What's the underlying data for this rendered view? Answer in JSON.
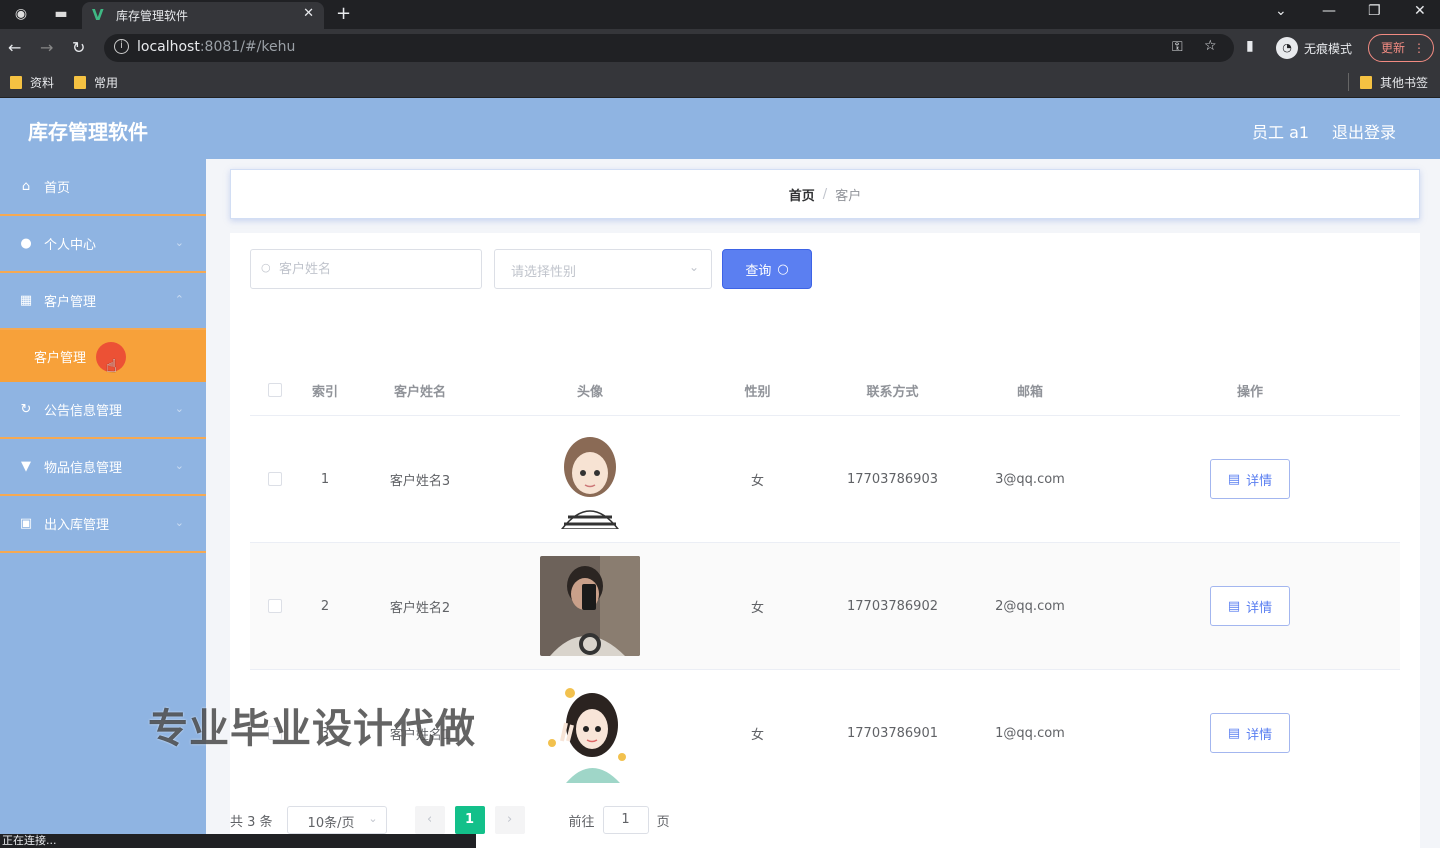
{
  "browser": {
    "tab_title": "库存管理软件",
    "tab_logo": "V",
    "url_host": "localhost",
    "url_path": ":8081/#/kehu",
    "incognito_label": "无痕模式",
    "update_label": "更新",
    "bookmarks": [
      "资料",
      "常用"
    ],
    "other_bookmarks": "其他书签",
    "status_text": "正在连接..."
  },
  "header": {
    "title": "库存管理软件",
    "user": "员工 a1",
    "logout": "退出登录"
  },
  "sidebar": {
    "items": [
      {
        "label": "首页",
        "icon": "home-icon",
        "glyph": "⌂"
      },
      {
        "label": "个人中心",
        "icon": "user-icon",
        "glyph": "●"
      },
      {
        "label": "客户管理",
        "icon": "grid-icon",
        "glyph": "▦"
      }
    ],
    "sub_active": "客户管理",
    "items_after": [
      {
        "label": "公告信息管理",
        "icon": "refresh-icon",
        "glyph": "↻"
      },
      {
        "label": "物品信息管理",
        "icon": "trophy-icon",
        "glyph": "▼"
      },
      {
        "label": "出入库管理",
        "icon": "box-icon",
        "glyph": "▣"
      }
    ]
  },
  "breadcrumb": {
    "home": "首页",
    "sep": "/",
    "current": "客户"
  },
  "search": {
    "name_placeholder": "客户姓名",
    "gender_placeholder": "请选择性别",
    "query_label": "查询"
  },
  "table": {
    "columns": [
      "索引",
      "客户姓名",
      "头像",
      "性别",
      "联系方式",
      "邮箱",
      "操作"
    ],
    "rows": [
      {
        "index": "1",
        "name": "客户姓名3",
        "gender": "女",
        "phone": "17703786903",
        "email": "3@qq.com",
        "action": "详情",
        "avatar": "girl-avatar"
      },
      {
        "index": "2",
        "name": "客户姓名2",
        "gender": "女",
        "phone": "17703786902",
        "email": "2@qq.com",
        "action": "详情",
        "avatar": "man-selfie-photo"
      },
      {
        "index": "3",
        "name": "客户姓名1",
        "gender": "女",
        "phone": "17703786901",
        "email": "1@qq.com",
        "action": "详情",
        "avatar": "girl-peace-avatar"
      }
    ]
  },
  "pagination": {
    "total": "共 3 条",
    "page_size": "10条/页",
    "current_page": "1",
    "goto_label": "前往",
    "goto_value": "1",
    "page_unit": "页"
  },
  "watermark": "专业毕业设计代做",
  "colors": {
    "header_bg": "#8fb4e2",
    "active_menu": "#f7a13a",
    "primary": "#5b7ff1",
    "pager_active": "#13c08a"
  }
}
